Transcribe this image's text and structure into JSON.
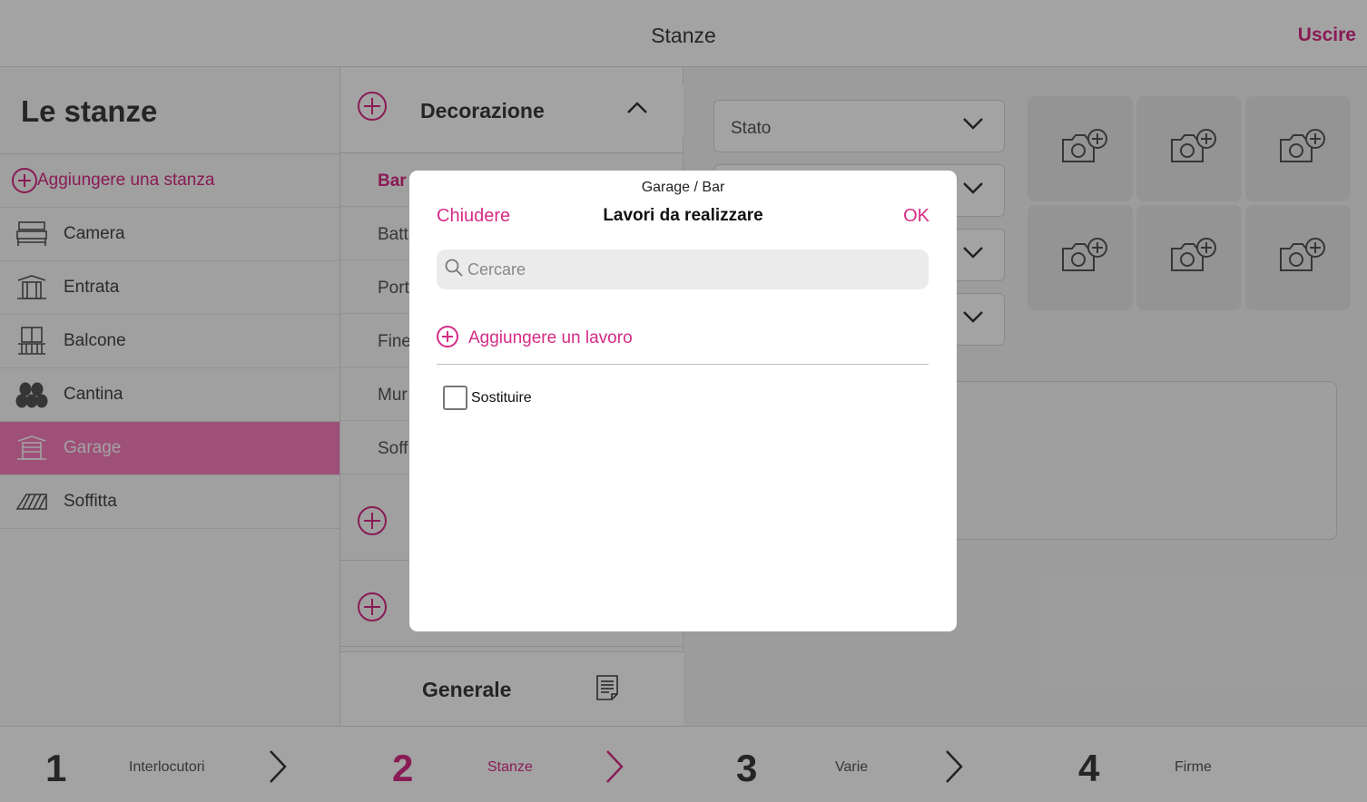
{
  "topbar": {
    "title": "Stanze",
    "exit_label": "Uscire"
  },
  "rooms": {
    "heading": "Le stanze",
    "add_label": "Aggiungere una stanza",
    "items": [
      {
        "label": "Camera",
        "icon": "bed-icon"
      },
      {
        "label": "Entrata",
        "icon": "entrance-icon"
      },
      {
        "label": "Balcone",
        "icon": "balcony-icon"
      },
      {
        "label": "Cantina",
        "icon": "barrels-icon"
      },
      {
        "label": "Garage",
        "icon": "garage-icon",
        "active": true
      },
      {
        "label": "Soffitta",
        "icon": "attic-icon"
      }
    ]
  },
  "categories": {
    "section_label": "Decorazione",
    "items": [
      "Bar",
      "Batt",
      "Port",
      "Fine",
      "Mur",
      "Soff"
    ],
    "general_label": "Generale"
  },
  "details": {
    "select_value": "Stato"
  },
  "stepper": {
    "steps": [
      {
        "number": "1",
        "label": "Interlocutori"
      },
      {
        "number": "2",
        "label": "Stanze",
        "active": true
      },
      {
        "number": "3",
        "label": "Varie"
      },
      {
        "number": "4",
        "label": "Firme"
      }
    ]
  },
  "modal": {
    "breadcrumb": "Garage / Bar",
    "title": "Lavori da realizzare",
    "close_label": "Chiudere",
    "ok_label": "OK",
    "search_placeholder": "Cercare",
    "add_label": "Aggiungere un lavoro",
    "items": [
      {
        "label": "Sostituire",
        "checked": false
      }
    ]
  },
  "colors": {
    "accent": "#d62b86",
    "active_row": "#f87dbc"
  }
}
